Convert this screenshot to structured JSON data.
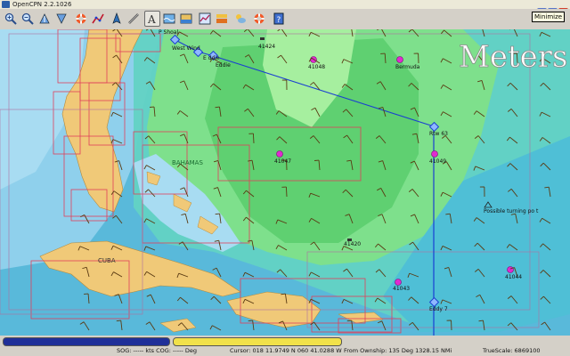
{
  "window": {
    "title": "OpenCPN 2.2.1026",
    "tooltip": "Minimize"
  },
  "toolbar": {
    "buttons": [
      {
        "name": "zoom-in",
        "icon": "zoom-in-icon"
      },
      {
        "name": "zoom-out",
        "icon": "zoom-out-icon"
      },
      {
        "name": "scale-in",
        "icon": "scale-in-icon"
      },
      {
        "name": "scale-out",
        "icon": "scale-out-icon"
      },
      {
        "name": "route",
        "icon": "lifebuoy-icon"
      },
      {
        "name": "route-create",
        "icon": "route-icon"
      },
      {
        "name": "auto-follow",
        "icon": "ship-icon"
      },
      {
        "name": "measure",
        "icon": "ruler-icon"
      },
      {
        "name": "text",
        "icon": "text-icon"
      },
      {
        "name": "current",
        "icon": "current-icon"
      },
      {
        "name": "tide",
        "icon": "tide-icon"
      },
      {
        "name": "settings",
        "icon": "settings-icon"
      },
      {
        "name": "chart-display",
        "icon": "layers-icon"
      },
      {
        "name": "weather",
        "icon": "weather-icon"
      },
      {
        "name": "mob",
        "icon": "lifebuoy-icon"
      },
      {
        "name": "help",
        "icon": "help-icon"
      }
    ]
  },
  "chart": {
    "watermark": "Meters",
    "labels": {
      "bahamas": "BAHAMAS",
      "cuba": "CUBA",
      "b_tl": "P Shoal",
      "west_wind": "West Wind",
      "eddie_top": "E ddie",
      "eddie": "Eddie",
      "buoy_41424": "41424",
      "buoy_41048": "41048",
      "bermuda": "Bermuda",
      "waypoint_63": "Rtw 63",
      "buoy_41047": "41047",
      "buoy_41049": "41049",
      "turning": "Possible turning po t",
      "buoy_41420": "41420",
      "buoy_41043": "41043",
      "buoy_41044": "41044",
      "eddy7": "Eddy 7"
    }
  },
  "status": {
    "sog": "SOG: ----- kts  COG: ----- Deg",
    "cursor": "Cursor: 018 11.9749 N 060 41.0288 W",
    "ownship": "From Ownship: 135 Deg  1328.15 NMi",
    "truescale": "TrueScale:  6869100"
  },
  "colors": {
    "deep_water": "#56b6d8",
    "mid_water": "#7cc8e6",
    "shallow": "#a8dcf2",
    "land": "#f0c978",
    "wave_green": "#69d77d",
    "wave_cyan": "#5fcfc2",
    "route": "#1a3fd1",
    "bar_blue": "#1f2f98",
    "bar_yellow": "#f1e14a"
  }
}
